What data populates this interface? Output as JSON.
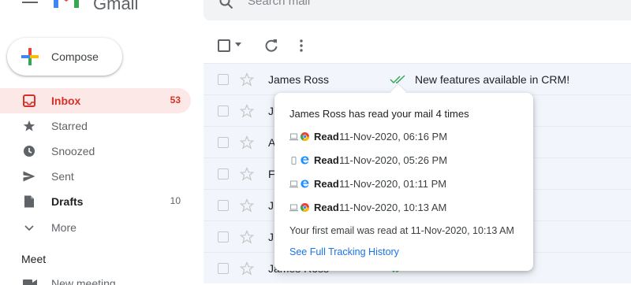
{
  "app": {
    "name": "Gmail"
  },
  "search": {
    "placeholder": "Search mail"
  },
  "compose": {
    "label": "Compose"
  },
  "sidebar": {
    "items": [
      {
        "label": "Inbox",
        "count": "53",
        "icon": "inbox-icon"
      },
      {
        "label": "Starred",
        "count": "",
        "icon": "star-icon"
      },
      {
        "label": "Snoozed",
        "count": "",
        "icon": "clock-icon"
      },
      {
        "label": "Sent",
        "count": "",
        "icon": "send-icon"
      },
      {
        "label": "Drafts",
        "count": "10",
        "icon": "draft-icon"
      },
      {
        "label": "More",
        "count": "",
        "icon": "chevron-down-icon"
      }
    ],
    "meet_heading": "Meet",
    "new_meeting_label": "New meeting"
  },
  "mail_list": {
    "rows": [
      {
        "sender": "James Ross",
        "subject": "New features available in CRM!"
      },
      {
        "sender": "J",
        "subject": ""
      },
      {
        "sender": "A",
        "subject": ""
      },
      {
        "sender": "F",
        "subject": ""
      },
      {
        "sender": "J",
        "subject": ""
      },
      {
        "sender": "J",
        "subject": ""
      },
      {
        "sender": "James Ross",
        "subject": ""
      }
    ]
  },
  "popover": {
    "title": "James Ross has read your mail 4 times",
    "reads": [
      {
        "device": "laptop-icon",
        "browser": "chrome-icon",
        "label": "Read",
        "time": "11-Nov-2020, 06:16 PM"
      },
      {
        "device": "mobile-icon",
        "browser": "edge-icon",
        "label": "Read",
        "time": "11-Nov-2020, 05:26 PM"
      },
      {
        "device": "laptop-icon",
        "browser": "edge-icon",
        "label": "Read",
        "time": "11-Nov-2020, 01:11 PM"
      },
      {
        "device": "laptop-icon",
        "browser": "chrome-icon",
        "label": "Read",
        "time": "11-Nov-2020, 10:13 AM"
      }
    ],
    "first_read": "Your first email was read at 11-Nov-2020, 10:13 AM",
    "history_link": "See Full Tracking History"
  },
  "colors": {
    "accent_red": "#d93025",
    "active_bg": "#fce8e6",
    "link_blue": "#1a73e8",
    "read_tick_green": "#34a853"
  }
}
